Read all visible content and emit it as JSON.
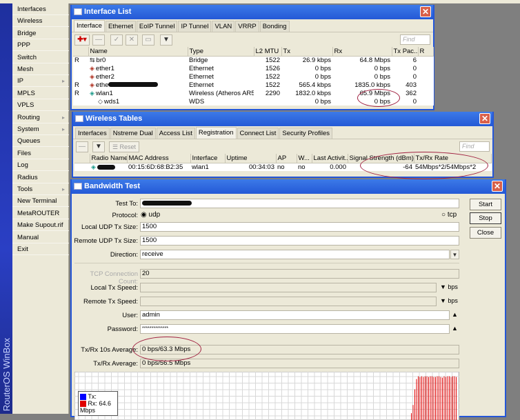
{
  "sidebar": {
    "brand": "RouterOS WinBox",
    "items": [
      {
        "label": "Interfaces"
      },
      {
        "label": "Wireless"
      },
      {
        "label": "Bridge"
      },
      {
        "label": "PPP"
      },
      {
        "label": "Switch"
      },
      {
        "label": "Mesh"
      },
      {
        "label": "IP",
        "submenu": true
      },
      {
        "label": "MPLS"
      },
      {
        "label": "VPLS"
      },
      {
        "label": "Routing",
        "submenu": true
      },
      {
        "label": "System",
        "submenu": true
      },
      {
        "label": "Queues"
      },
      {
        "label": "Files"
      },
      {
        "label": "Log"
      },
      {
        "label": "Radius"
      },
      {
        "label": "Tools",
        "submenu": true
      },
      {
        "label": "New Terminal"
      },
      {
        "label": "MetaROUTER"
      },
      {
        "label": "Make Supout.rif"
      },
      {
        "label": "Manual"
      },
      {
        "label": "Exit"
      }
    ]
  },
  "interface_list": {
    "title": "Interface List",
    "tabs": [
      "Interface",
      "Ethernet",
      "EoIP Tunnel",
      "IP Tunnel",
      "VLAN",
      "VRRP",
      "Bonding"
    ],
    "find": "Find",
    "columns": [
      "",
      "Name",
      "Type",
      "L2 MTU",
      "Tx",
      "Rx",
      "Tx Pac...",
      "R"
    ],
    "rows": [
      {
        "flag": "R",
        "name": "br0",
        "type": "Bridge",
        "mtu": "1522",
        "tx": "26.9 kbps",
        "rx": "64.8 Mbps",
        "txp": "6",
        "icon": "bridge"
      },
      {
        "flag": "",
        "name": "ether1",
        "type": "Ethernet",
        "mtu": "1526",
        "tx": "0 bps",
        "rx": "0 bps",
        "txp": "0",
        "icon": "ethernet"
      },
      {
        "flag": "",
        "name": "ether2",
        "type": "Ethernet",
        "mtu": "1522",
        "tx": "0 bps",
        "rx": "0 bps",
        "txp": "0",
        "icon": "ethernet"
      },
      {
        "flag": "R",
        "name": "ethe",
        "type": "Ethernet",
        "mtu": "1522",
        "tx": "565.4 kbps",
        "rx": "1835.0 kbps",
        "txp": "403",
        "icon": "ethernet",
        "redacted": true
      },
      {
        "flag": "R",
        "name": "wlan1",
        "type": "Wireless (Atheros AR5...",
        "mtu": "2290",
        "tx": "1832.0 kbps",
        "rx": "65.9 Mbps",
        "txp": "362",
        "icon": "wireless"
      },
      {
        "flag": "",
        "name": "wds1",
        "type": "WDS",
        "mtu": "",
        "tx": "0 bps",
        "rx": "0 bps",
        "txp": "0",
        "icon": "wds"
      }
    ]
  },
  "wireless_tables": {
    "title": "Wireless Tables",
    "tabs": [
      "Interfaces",
      "Nstreme Dual",
      "Access List",
      "Registration",
      "Connect List",
      "Security Profiles"
    ],
    "reset": "Reset",
    "find": "Find",
    "columns": [
      "Radio Name",
      "MAC Address",
      "Interface",
      "Uptime",
      "AP",
      "W...",
      "Last Activit...",
      "Signal Strength (dBm)",
      "Tx/Rx Rate"
    ],
    "rows": [
      {
        "mac": "00:15:6D:68:B2:35",
        "iface": "wlan1",
        "uptime": "00:34:03",
        "ap": "no",
        "w": "no",
        "last": "0.000",
        "signal": "-64",
        "rate": "54Mbps*2/54Mbps*2"
      }
    ]
  },
  "bandwidth_test": {
    "title": "Bandwidth Test",
    "labels": {
      "test_to": "Test To:",
      "protocol": "Protocol:",
      "local_udp": "Local UDP Tx Size:",
      "remote_udp": "Remote UDP Tx Size:",
      "direction": "Direction:",
      "tcp_count": "TCP Connection Count:",
      "local_speed": "Local Tx Speed:",
      "remote_speed": "Remote Tx Speed:",
      "user": "User:",
      "password": "Password:",
      "avg10": "Tx/Rx 10s Average:",
      "avg": "Tx/Rx Average:"
    },
    "protocol_udp": "udp",
    "protocol_tcp": "tcp",
    "local_udp": "1500",
    "remote_udp": "1500",
    "direction": "receive",
    "tcp_count": "20",
    "bps": "bps",
    "user": "admin",
    "password": "**************",
    "avg10": "0 bps/63.3 Mbps",
    "avg": "0 bps/56.5 Mbps",
    "buttons": {
      "start": "Start",
      "stop": "Stop",
      "close": "Close"
    },
    "legend": {
      "tx": "Tx:",
      "rx": "Rx:  64.6 Mbps"
    },
    "colors": {
      "tx": "#0000ff",
      "rx": "#e00000"
    },
    "rx_graph_mbps": [
      10,
      22,
      45,
      60,
      64,
      63,
      64,
      63,
      64,
      64,
      63,
      64,
      64,
      63,
      63,
      64,
      64,
      63,
      62,
      64,
      63,
      64,
      64,
      63,
      64,
      64,
      63
    ]
  }
}
